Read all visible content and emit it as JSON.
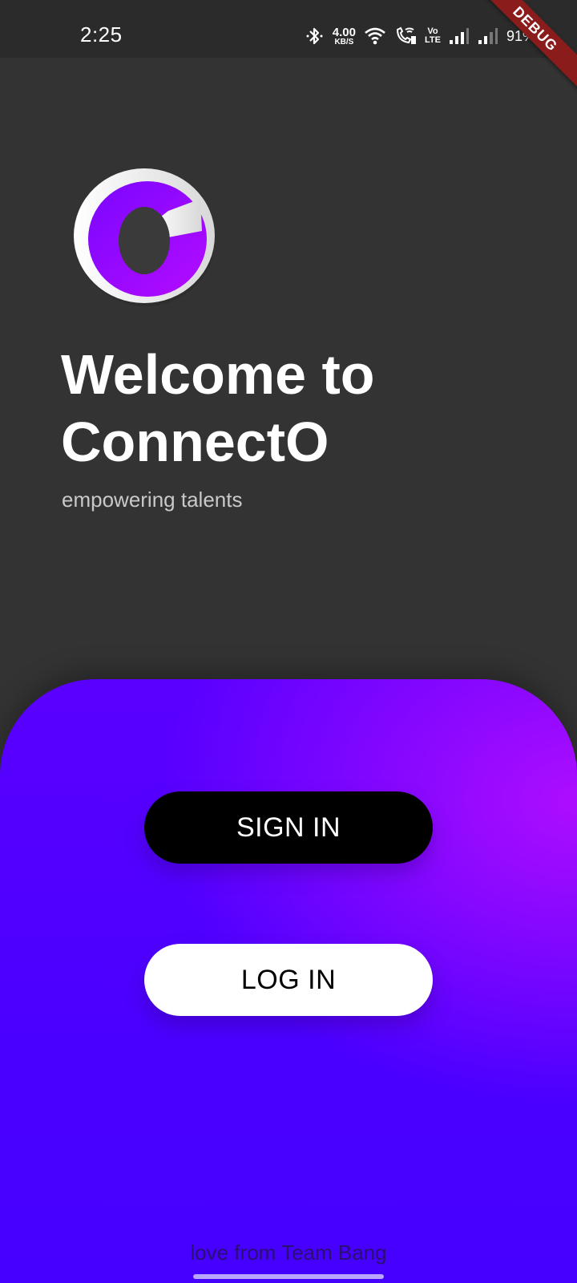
{
  "status_bar": {
    "time": "2:25",
    "net_speed_value": "4.00",
    "net_speed_unit": "KB/S",
    "volte_top": "Vo",
    "volte_bottom": "LTE",
    "battery_pct": "91%",
    "debug_label": "DEBUG",
    "icons": [
      "bluetooth-icon",
      "wifi-icon",
      "wifi-calling-icon",
      "volte-icon",
      "signal-icon",
      "signal-icon",
      "battery-charging-icon"
    ]
  },
  "welcome": {
    "logo_icon": "connecto-logo",
    "title": "Welcome to ConnectO",
    "subtitle": "empowering talents"
  },
  "actions": {
    "sign_in_label": "SIGN IN",
    "log_in_label": "LOG IN"
  },
  "footer": {
    "credit": "love from Team Bang"
  },
  "colors": {
    "background": "#333333",
    "panel_start": "#4600ff",
    "panel_accent": "#b20eff",
    "sign_in_bg": "#000000",
    "log_in_bg": "#ffffff",
    "debug_ribbon": "#8a1c1c"
  }
}
